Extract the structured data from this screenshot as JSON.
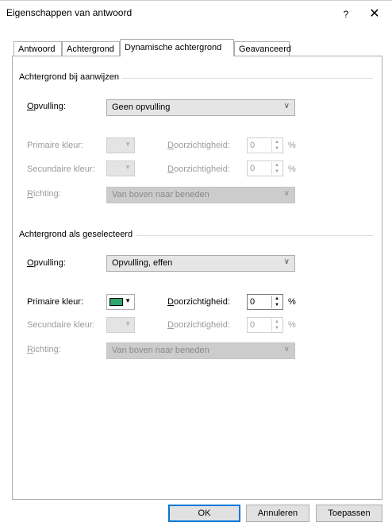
{
  "window": {
    "title": "Eigenschappen van antwoord",
    "help_label": "?",
    "close_label": "✕"
  },
  "tabs": [
    {
      "label": "Antwoord"
    },
    {
      "label": "Achtergrond"
    },
    {
      "label": "Dynamische achtergrond"
    },
    {
      "label": "Geavanceerd"
    }
  ],
  "section_hover": {
    "title": "Achtergrond bij aanwijzen",
    "fill_label_u": "O",
    "fill_label_rest": "pvulling:",
    "fill_value": "Geen opvulling",
    "primary_color_label": "Primaire kleur:",
    "primary_transparency_label_u": "D",
    "primary_transparency_label_rest": "oorzichtigheid:",
    "primary_transparency_value": "0",
    "secondary_color_label": "Secundaire kleur:",
    "secondary_transparency_label_u": "D",
    "secondary_transparency_label_rest": "oorzichtigheid:",
    "secondary_transparency_value": "0",
    "direction_label_u": "R",
    "direction_label_rest": "ichting:",
    "direction_value": "Van boven naar beneden",
    "percent": "%"
  },
  "section_selected": {
    "title": "Achtergrond als geselecteerd",
    "fill_label_u": "O",
    "fill_label_rest": "pvulling:",
    "fill_value": "Opvulling, effen",
    "primary_color_label": "Primaire kleur:",
    "primary_color_hex": "#2ea66b",
    "primary_transparency_label_u": "D",
    "primary_transparency_label_rest": "oorzichtigheid:",
    "primary_transparency_value": "0",
    "secondary_color_label": "Secundaire kleur:",
    "secondary_transparency_label_u": "D",
    "secondary_transparency_label_rest": "oorzichtigheid:",
    "secondary_transparency_value": "0",
    "direction_label_u": "R",
    "direction_label_rest": "ichting:",
    "direction_value": "Van boven naar beneden",
    "percent": "%"
  },
  "footer": {
    "ok_label": "OK",
    "cancel_label": "Annuleren",
    "apply_label": "Toepassen"
  },
  "icons": {
    "chevron": "chevron-down-icon",
    "spin_up": "spin-up-icon",
    "spin_down": "spin-down-icon"
  }
}
